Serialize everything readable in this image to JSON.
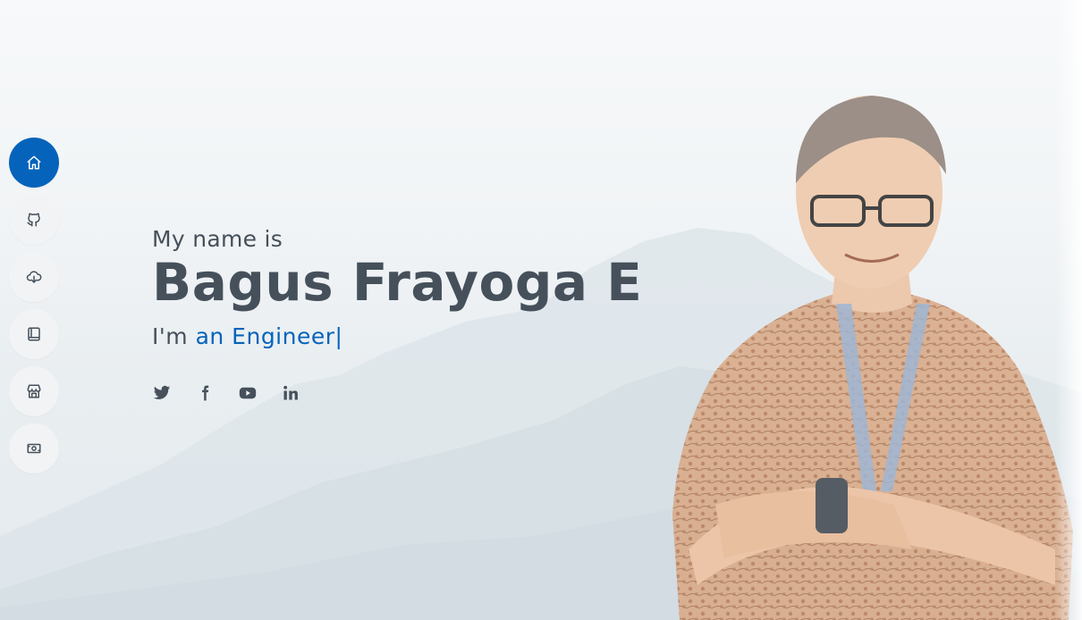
{
  "nav": {
    "items": [
      {
        "icon": "home-icon",
        "active": true
      },
      {
        "icon": "github-icon",
        "active": false
      },
      {
        "icon": "cloud-download-icon",
        "active": false
      },
      {
        "icon": "book-icon",
        "active": false
      },
      {
        "icon": "shop-icon",
        "active": false
      },
      {
        "icon": "cash-icon",
        "active": false
      }
    ]
  },
  "hero": {
    "intro": "My name is",
    "name": "Bagus Frayoga E",
    "role_prefix": "I'm",
    "role_typed": "an Engineer",
    "role_cursor": "|"
  },
  "socials": [
    {
      "icon": "twitter-icon"
    },
    {
      "icon": "facebook-icon"
    },
    {
      "icon": "youtube-icon"
    },
    {
      "icon": "linkedin-icon"
    }
  ],
  "colors": {
    "accent": "#0563bb",
    "text": "#45505b",
    "nav_bg": "#f2f3f5"
  }
}
